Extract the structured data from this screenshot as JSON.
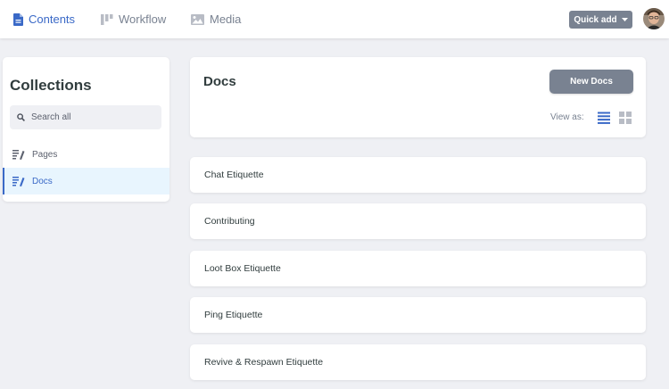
{
  "topnav": {
    "contents": "Contents",
    "workflow": "Workflow",
    "media": "Media",
    "quick_add": "Quick add"
  },
  "sidebar": {
    "title": "Collections",
    "search_placeholder": "Search all",
    "items": [
      {
        "label": "Pages"
      },
      {
        "label": "Docs"
      }
    ]
  },
  "main": {
    "title": "Docs",
    "new_button": "New Docs",
    "view_as": "View as:"
  },
  "entries": [
    "Chat Etiquette",
    "Contributing",
    "Loot Box Etiquette",
    "Ping Etiquette",
    "Revive & Respawn Etiquette"
  ],
  "colors": {
    "accent": "#3a69c7",
    "button_gray": "#798291",
    "background": "#eff0f4",
    "active_bg": "#e8f5fe"
  }
}
